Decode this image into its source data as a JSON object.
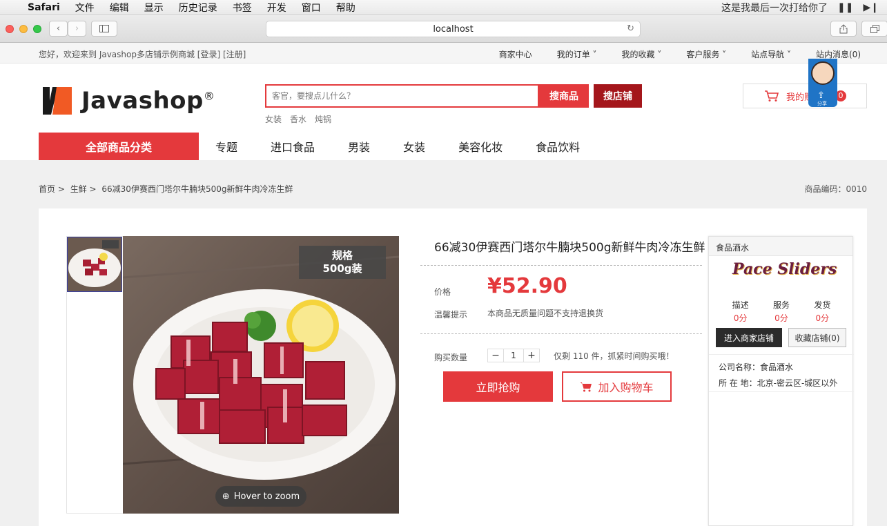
{
  "os_menubar": {
    "app": "Safari",
    "items": [
      "文件",
      "编辑",
      "显示",
      "历史记录",
      "书签",
      "开发",
      "窗口",
      "帮助"
    ],
    "status_text": "这是我最后一次打给你了"
  },
  "browser": {
    "url": "localhost"
  },
  "sitebar": {
    "welcome": "您好，欢迎来到 Javashop多店铺示例商城 [登录] [注册]",
    "links": [
      "商家中心",
      "我的订单 ˅",
      "我的收藏 ˅",
      "客户服务 ˅",
      "站点导航 ˅",
      "站内消息(0)"
    ]
  },
  "header": {
    "logo_text": "Javashop",
    "logo_reg": "®",
    "search_placeholder": "客官，要搜点儿什么？",
    "search_goods_label": "搜商品",
    "search_shop_label": "搜店铺",
    "hotwords": [
      "女装",
      "香水",
      "炖锅"
    ],
    "cart_label": "我的购物车",
    "cart_count": "0"
  },
  "nav": {
    "all_categories": "全部商品分类",
    "items": [
      "专题",
      "进口食品",
      "男装",
      "女装",
      "美容化妆",
      "食品饮料"
    ]
  },
  "breadcrumb": {
    "items": [
      "首页 >",
      "生鲜 >",
      "66减30伊赛西门塔尔牛腩块500g新鲜牛肉冷冻生鲜"
    ],
    "goods_code": "商品编码：0010"
  },
  "product": {
    "title": "66减30伊赛西门塔尔牛腩块500g新鲜牛肉冷冻生鲜",
    "price_label": "价格",
    "price": "¥52.90",
    "tip_label": "温馨提示",
    "tip": "本商品无质量问题不支持退换货",
    "qty_label": "购买数量",
    "qty": "1",
    "stock_text": "仅剩 110 件，抓紧时间购买哦！",
    "spec_line1": "规格",
    "spec_line2": "500g装",
    "zoom_hint": "Hover to zoom",
    "buy_now": "立即抢购",
    "add_cart": "加入购物车"
  },
  "shop": {
    "name": "食品酒水",
    "logo_text": "Pace Sliders",
    "score_labels": [
      "描述",
      "服务",
      "发货"
    ],
    "score_values": [
      "0分",
      "0分",
      "0分"
    ],
    "enter_label": "进入商家店铺",
    "fav_label": "收藏店铺(0)",
    "company_line": "公司名称：食品酒水",
    "location_line": "所 在 地：北京-密云区-城区以外"
  },
  "share_widget": {
    "label": "分享"
  },
  "colors": {
    "brand_red": "#e4393c",
    "dark_red": "#a4161b",
    "shop_dark": "#2b2b2b"
  }
}
